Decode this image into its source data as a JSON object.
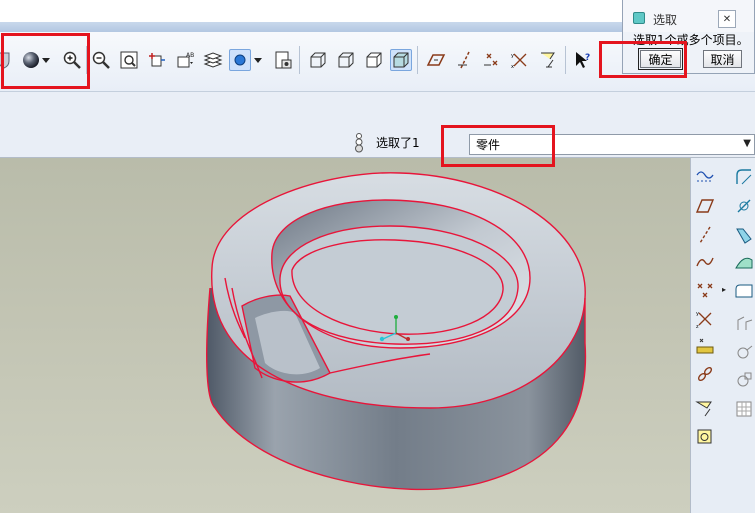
{
  "dialog": {
    "title": "选取",
    "close_symbol": "✕",
    "message": "选取1个或多个项目。",
    "ok_label": "确定",
    "cancel_label": "取消"
  },
  "status": {
    "selected_count": "选取了1",
    "filter_value": "零件"
  },
  "toolbar_icons": [
    "shield-icon",
    "shaded-sphere-icon",
    "dropdown-arrow-icon",
    "zoom-in-icon",
    "zoom-out-icon",
    "refit-icon",
    "reorient-icon",
    "saved-views-icon",
    "layers-icon",
    "appearance-icon",
    "appearance-dropdown-icon",
    "view-manager-icon",
    "wireframe-icon",
    "hidden-line-icon",
    "no-hidden-icon",
    "shading-icon",
    "datum-plane-display-icon",
    "datum-axis-display-icon",
    "datum-point-display-icon",
    "coordinate-system-display-icon",
    "annotation-display-icon",
    "context-help-icon"
  ],
  "right_toolbar_icons": [
    "sketched-curve-icon",
    "datum-plane-icon",
    "datum-axis-icon",
    "datum-curve-icon",
    "datum-point-icon",
    "coordinate-system-icon",
    "analysis-feature-icon",
    "chain-icon",
    "annotation-feature-icon",
    "repeat-icon",
    "round-icon",
    "chamfer-icon",
    "sweep-icon",
    "boundary-blend-icon",
    "mirror-icon",
    "shell-icon",
    "draft-icon",
    "pattern-icon"
  ],
  "colors": {
    "selection_highlight": "#e8153a",
    "annotation_box": "#e4141e",
    "model_fill": "#c4ccd4"
  }
}
